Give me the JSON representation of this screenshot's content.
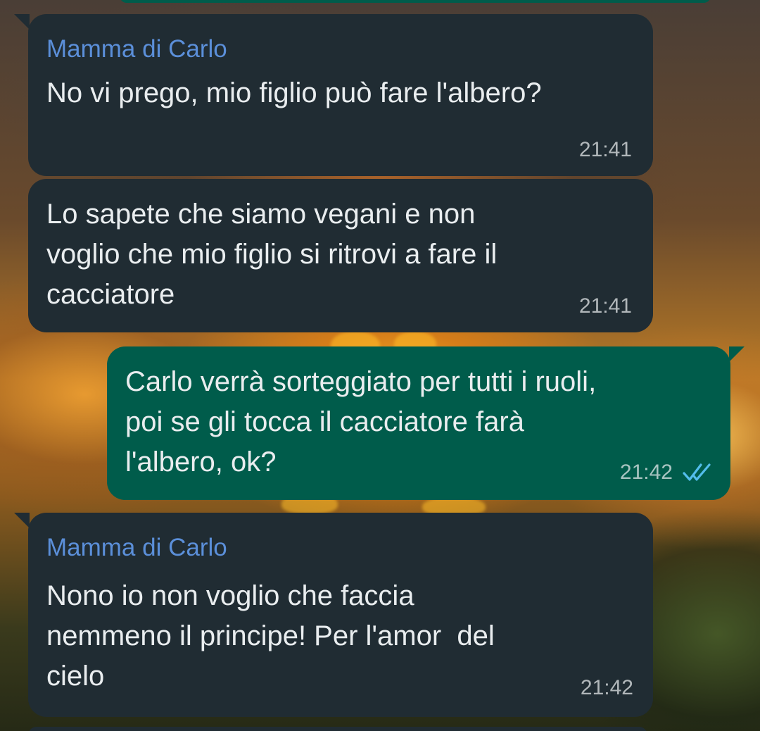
{
  "messages": [
    {
      "direction": "incoming",
      "sender": "Mamma di Carlo",
      "text": "No vi prego, mio figlio può fare l'albero?",
      "time": "21:41"
    },
    {
      "direction": "incoming",
      "text": "Lo sapete che siamo vegani e non\nvoglio che mio figlio si ritrovi a fare il\ncacciatore",
      "time": "21:41"
    },
    {
      "direction": "outgoing",
      "text": "Carlo verrà sorteggiato per tutti i ruoli,\npoi se gli tocca il cacciatore farà\nl'albero, ok?",
      "time": "21:42",
      "status_icon": "double-check-read-icon"
    },
    {
      "direction": "incoming",
      "sender": "Mamma di Carlo",
      "text": "Nono io non voglio che faccia\nnemmeno il principe! Per l'amor  del\ncielo",
      "time": "21:42"
    }
  ],
  "colors": {
    "incoming_bubble": "#202c33",
    "outgoing_bubble": "#005c4b",
    "sender_name": "#5b8fd9",
    "read_check": "#53bdeb",
    "text": "#e9edef"
  }
}
